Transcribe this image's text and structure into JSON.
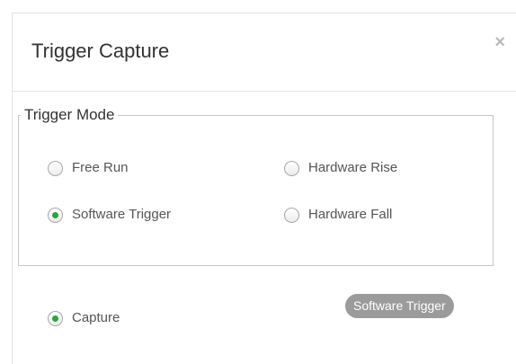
{
  "dialog": {
    "title": "Trigger Capture",
    "close_label": "×"
  },
  "trigger_mode": {
    "legend": "Trigger Mode",
    "options": [
      {
        "label": "Free Run",
        "checked": false
      },
      {
        "label": "Hardware Rise",
        "checked": false
      },
      {
        "label": "Software Trigger",
        "checked": true
      },
      {
        "label": "Hardware Fall",
        "checked": false
      }
    ]
  },
  "capture": {
    "label": "Capture",
    "checked": true
  },
  "software_trigger_button": {
    "label": "Software Trigger"
  },
  "colors": {
    "radio_checked": "#2aa63a",
    "button_bg": "#9b9b9b"
  }
}
